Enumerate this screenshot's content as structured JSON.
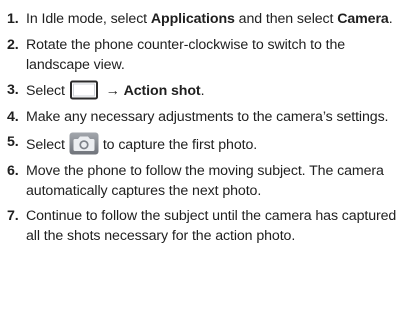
{
  "steps": [
    {
      "number": "1.",
      "text_a": "In Idle mode, select ",
      "bold_a": "Applications",
      "text_b": " and then select ",
      "bold_b": "Camera",
      "text_c": "."
    },
    {
      "number": "2.",
      "text": "Rotate the phone counter-clockwise to switch to the landscape view."
    },
    {
      "number": "3.",
      "text_a": "Select",
      "icon": "shooting-mode-icon",
      "arrow": " → ",
      "bold_a": "Action shot",
      "text_b": "."
    },
    {
      "number": "4.",
      "text": "Make any necessary adjustments to the camera’s settings."
    },
    {
      "number": "5.",
      "text_a": "Select",
      "icon": "camera-shutter-icon",
      "text_b": "to capture the first photo."
    },
    {
      "number": "6.",
      "text": "Move the phone to follow the moving subject. The camera automatically captures the next photo."
    },
    {
      "number": "7.",
      "text": "Continue to follow the subject until the camera has captured all the shots necessary for the action photo."
    }
  ],
  "colors": {
    "text": "#1f1f1f",
    "mode_icon_border": "#2a2a2a",
    "camera_icon_bg": "#8b8f96",
    "camera_icon_lens": "#e9ebee"
  }
}
